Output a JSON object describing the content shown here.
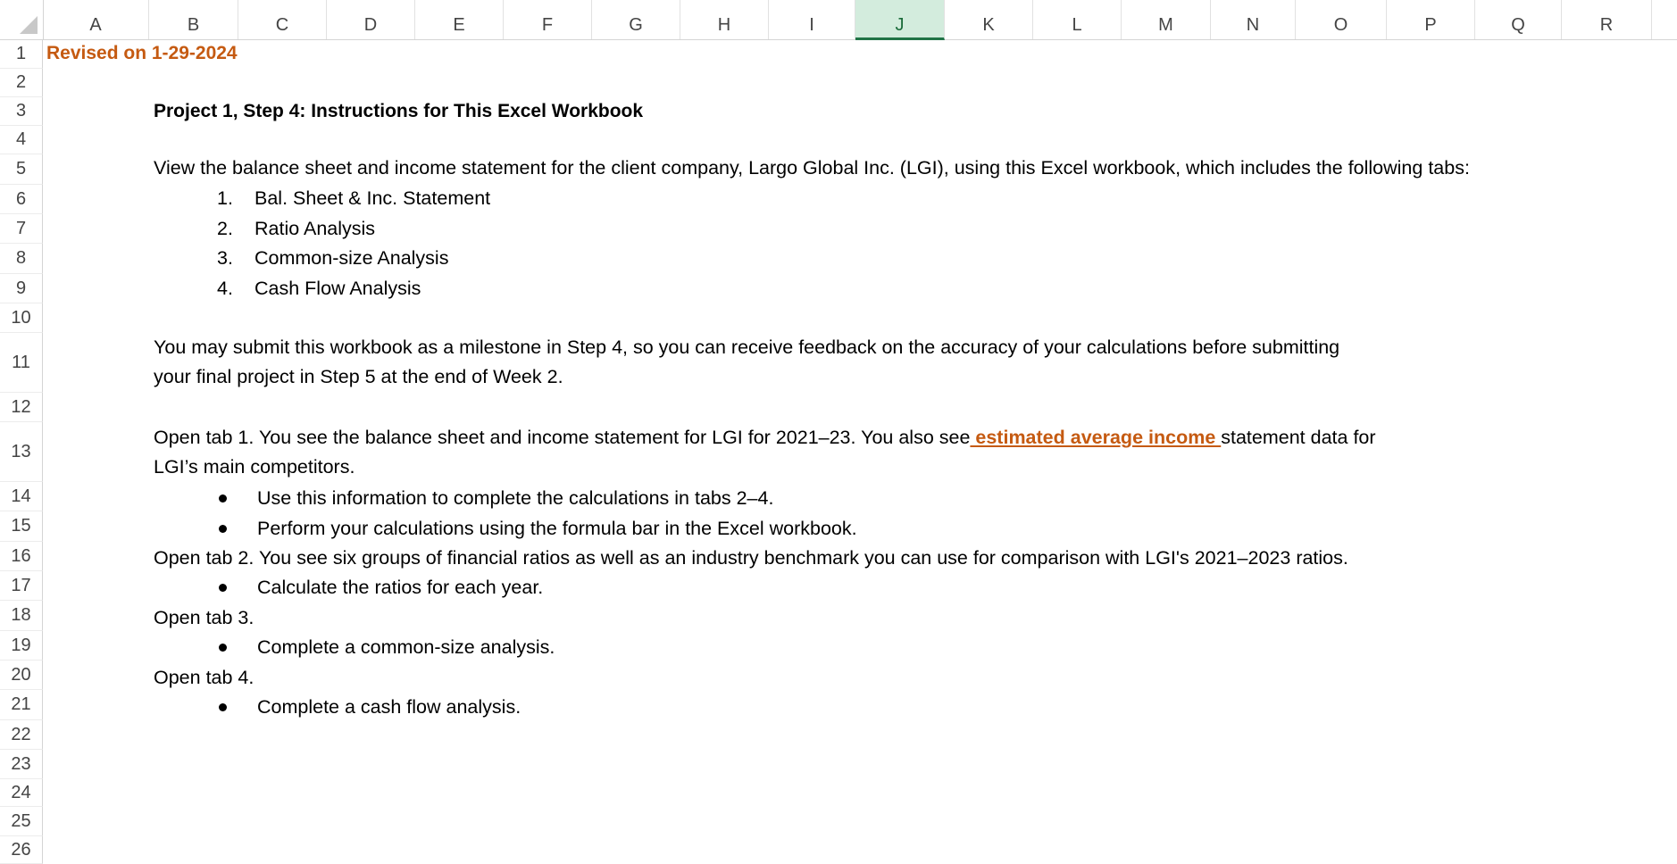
{
  "sheet": {
    "columns": [
      "A",
      "B",
      "C",
      "D",
      "E",
      "F",
      "G",
      "H",
      "I",
      "J",
      "K",
      "L",
      "M",
      "N",
      "O",
      "P",
      "Q",
      "R"
    ],
    "selected_column": "J",
    "rows": [
      "1",
      "2",
      "3",
      "4",
      "5",
      "6",
      "7",
      "8",
      "9",
      "10",
      "11",
      "12",
      "13",
      "14",
      "15",
      "16",
      "17",
      "18",
      "19",
      "20",
      "21",
      "22",
      "23",
      "24",
      "25",
      "26"
    ]
  },
  "cells": {
    "revised": "Revised on 1-29-2024",
    "title": "Project 1, Step 4: Instructions for This Excel Workbook",
    "intro": "View the balance sheet and income statement for the client company, Largo Global Inc. (LGI), using this Excel workbook, which includes the following tabs:",
    "tabs_list": [
      {
        "num": "1.",
        "label": "Bal. Sheet & Inc. Statement"
      },
      {
        "num": "2.",
        "label": "Ratio Analysis"
      },
      {
        "num": "3.",
        "label": "Common-size Analysis"
      },
      {
        "num": "4.",
        "label": "Cash Flow Analysis"
      }
    ],
    "submit_line1": "You may submit this workbook as a milestone in Step 4, so you can receive feedback on the accuracy of your calculations before submitting",
    "submit_line2": "your final project in Step 5 at the end of Week 2.",
    "tab1_part1": "Open tab 1. You see the balance sheet and income statement for LGI for  2021–23. You also see",
    "tab1_link": " estimated average income ",
    "tab1_part2": "statement data for",
    "tab1_line2": "LGI’s main competitors.",
    "tab1_bullet1": "Use this information to complete the calculations in tabs 2–4.",
    "tab1_bullet2": "Perform your calculations using the formula bar in the Excel workbook.",
    "tab2": "Open tab 2. You see six groups of financial ratios as well as an industry benchmark you can use for comparison with LGI's 2021–2023 ratios.",
    "tab2_bullet": "Calculate the ratios for each year.",
    "tab3": "Open tab 3.",
    "tab3_bullet": "Complete a common-size analysis.",
    "tab4": "Open tab 4.",
    "tab4_bullet": "Complete a cash flow analysis."
  },
  "colors": {
    "accent_orange": "#c55a11",
    "selected_header_bg": "#d3ecdd",
    "selected_header_border": "#217346"
  }
}
